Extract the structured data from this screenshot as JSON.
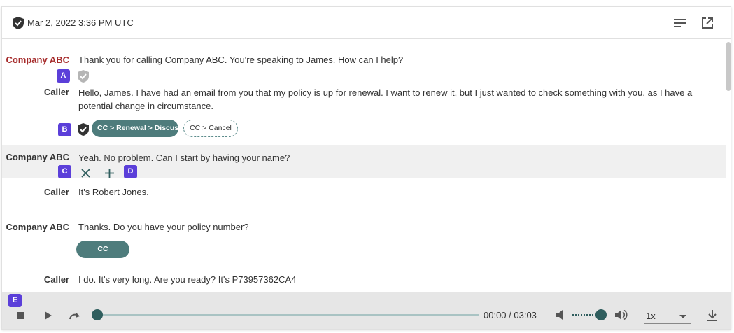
{
  "header": {
    "date": "Mar 2, 2022 3:36 PM UTC",
    "icons": [
      "shield-check-icon",
      "list-icon",
      "open-in-new-icon"
    ]
  },
  "transcript": [
    {
      "speaker": "Company ABC",
      "text": "Thank you for calling Company ABC. You're speaking to James. How can I help?",
      "badge": "A"
    },
    {
      "speaker": "Caller",
      "text": "Hello, James. I have had an email from you that my policy is up for renewal. I want to renew it, but I just wanted to check something with you, as I have a potential change in circumstance.",
      "badge": "B",
      "tags": [
        "CC > Renewal > Discuss",
        "CC > Cancel"
      ]
    },
    {
      "speaker": "Company ABC",
      "text": "Yeah. No problem. Can I start by having your name?",
      "badge_left": "C",
      "badge_right": "D"
    },
    {
      "speaker": "Caller",
      "text": "It's Robert Jones."
    },
    {
      "speaker": "Company ABC",
      "text": "Thanks. Do you have your policy number?",
      "tags": [
        "CC"
      ]
    },
    {
      "speaker": "Caller",
      "text": "I do. It's very long. Are you ready? It's P73957362CA4"
    }
  ],
  "player": {
    "badge": "E",
    "time": "00:00 / 03:03",
    "progress": 0,
    "volume": 0.85,
    "speed": "1x"
  },
  "colors": {
    "accent": "#4e7c7c",
    "badge": "#5b3fd9",
    "speaker_highlight": "#a52a2a"
  }
}
